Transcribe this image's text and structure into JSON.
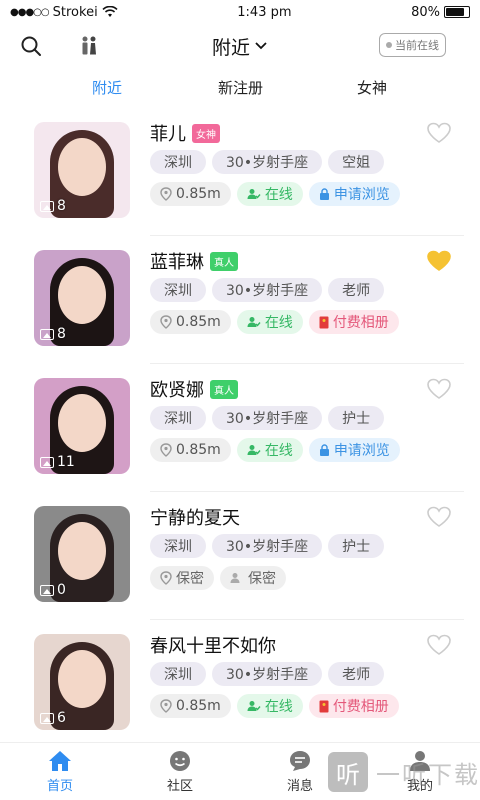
{
  "status_bar": {
    "carrier": "Strokei",
    "time": "1:43 pm",
    "battery": "80%",
    "battery_level": 0.8
  },
  "header": {
    "title": "附近",
    "online_filter": "当前在线"
  },
  "tabs": [
    {
      "label": "附近"
    },
    {
      "label": "新注册"
    },
    {
      "label": "女神"
    }
  ],
  "users": [
    {
      "name": "菲儿",
      "badge": "女神",
      "badge_type": "goddess",
      "photo_count": "8",
      "tags": [
        "深圳",
        "30•岁射手座",
        "空姐"
      ],
      "distance": "0.85m",
      "status": "在线",
      "action": "申请浏览",
      "action_type": "request",
      "liked": false
    },
    {
      "name": "蓝菲琳",
      "badge": "真人",
      "badge_type": "real",
      "photo_count": "8",
      "tags": [
        "深圳",
        "30•岁射手座",
        "老师"
      ],
      "distance": "0.85m",
      "status": "在线",
      "action": "付费相册",
      "action_type": "paid",
      "liked": true
    },
    {
      "name": "欧贤娜",
      "badge": "真人",
      "badge_type": "real",
      "photo_count": "11",
      "tags": [
        "深圳",
        "30•岁射手座",
        "护士"
      ],
      "distance": "0.85m",
      "status": "在线",
      "action": "申请浏览",
      "action_type": "request",
      "liked": false
    },
    {
      "name": "宁静的夏天",
      "badge": "",
      "badge_type": "",
      "photo_count": "0",
      "tags": [
        "深圳",
        "30•岁射手座",
        "护士"
      ],
      "distance": "保密",
      "status": "保密",
      "action": "",
      "action_type": "secret",
      "liked": false
    },
    {
      "name": "春风十里不如你",
      "badge": "",
      "badge_type": "",
      "photo_count": "6",
      "tags": [
        "深圳",
        "30•岁射手座",
        "老师"
      ],
      "distance": "0.85m",
      "status": "在线",
      "action": "付费相册",
      "action_type": "paid",
      "liked": false
    }
  ],
  "bottom_nav": [
    {
      "label": "首页"
    },
    {
      "label": "社区"
    },
    {
      "label": "消息"
    },
    {
      "label": "我的"
    }
  ],
  "watermark": {
    "glyph": "听",
    "text": "一听下载"
  },
  "colors": {
    "accent": "#2f8cf0",
    "heart_active": "#f5c232",
    "online": "#36b865"
  }
}
